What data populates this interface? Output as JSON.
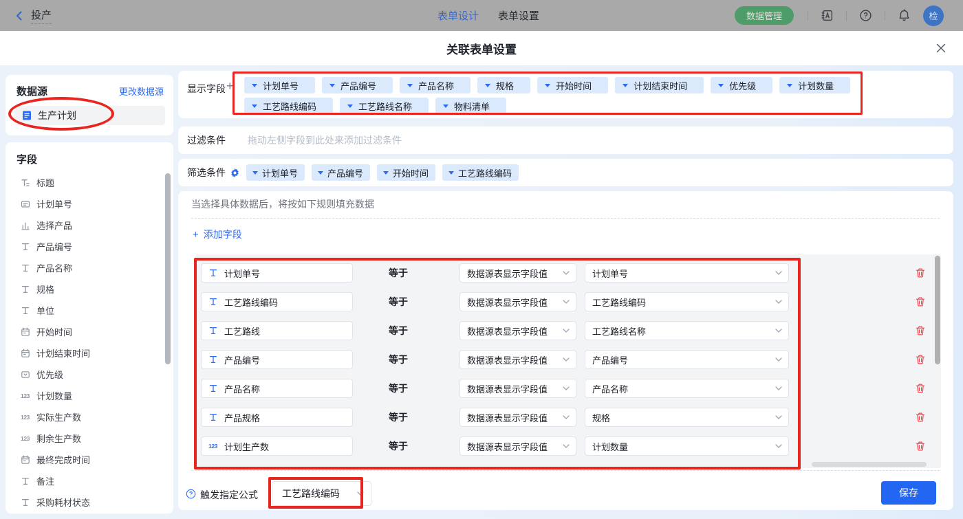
{
  "topbar": {
    "back_label": "投产",
    "tabs": [
      {
        "label": "表单设计"
      },
      {
        "label": "表单设置"
      }
    ],
    "data_manage_label": "数据管理",
    "avatar_text": "检"
  },
  "dialog": {
    "title": "关联表单设置"
  },
  "sidebar": {
    "datasource_heading": "数据源",
    "change_datasource_label": "更改数据源",
    "datasource_name": "生产计划",
    "fields_heading": "字段",
    "fields": [
      {
        "name": "标题",
        "type": "title"
      },
      {
        "name": "计划单号",
        "type": "serial"
      },
      {
        "name": "选择产品",
        "type": "selectdata"
      },
      {
        "name": "产品编号",
        "type": "text"
      },
      {
        "name": "产品名称",
        "type": "text"
      },
      {
        "name": "规格",
        "type": "text"
      },
      {
        "name": "单位",
        "type": "text"
      },
      {
        "name": "开始时间",
        "type": "date"
      },
      {
        "name": "计划结束时间",
        "type": "date"
      },
      {
        "name": "优先级",
        "type": "select"
      },
      {
        "name": "计划数量",
        "type": "number"
      },
      {
        "name": "实际生产数",
        "type": "number"
      },
      {
        "name": "剩余生产数",
        "type": "number"
      },
      {
        "name": "最终完成时间",
        "type": "date"
      },
      {
        "name": "备注",
        "type": "text"
      },
      {
        "name": "采购耗材状态",
        "type": "text"
      }
    ]
  },
  "display_fields": {
    "label": "显示字段",
    "add_label": "+",
    "row1": [
      "计划单号",
      "产品编号",
      "产品名称",
      "规格",
      "开始时间",
      "计划结束时间",
      "优先级",
      "计划数量"
    ],
    "row2": [
      "工艺路线编码",
      "工艺路线名称",
      "物料清单"
    ]
  },
  "filter_condition": {
    "label": "过滤条件",
    "placeholder": "拖动左侧字段到此处来添加过滤条件"
  },
  "sift_condition": {
    "label": "筛选条件",
    "chips": [
      "计划单号",
      "产品编号",
      "开始时间",
      "工艺路线编码"
    ]
  },
  "fill_rules": {
    "hint": "当选择具体数据后，将按如下规则填充数据",
    "add_plus": "+",
    "add_field_label": "添加字段",
    "operator": "等于",
    "source_option": "数据源表显示字段值",
    "rows": [
      {
        "field": "计划单号",
        "type": "text",
        "value": "计划单号"
      },
      {
        "field": "工艺路线编码",
        "type": "text",
        "value": "工艺路线编码"
      },
      {
        "field": "工艺路线",
        "type": "text",
        "value": "工艺路线名称"
      },
      {
        "field": "产品编号",
        "type": "text",
        "value": "产品编号"
      },
      {
        "field": "产品名称",
        "type": "text",
        "value": "产品名称"
      },
      {
        "field": "产品规格",
        "type": "text",
        "value": "规格"
      },
      {
        "field": "计划生产数",
        "type": "number",
        "value": "计划数量"
      }
    ]
  },
  "footer": {
    "trigger_label": "触发指定公式",
    "trigger_value": "工艺路线编码",
    "save_label": "保存"
  },
  "icons": {
    "number_glyph": "123"
  }
}
